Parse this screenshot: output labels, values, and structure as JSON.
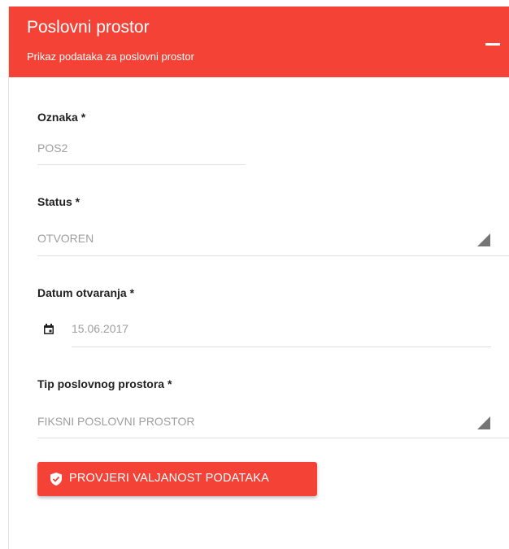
{
  "header": {
    "title": "Poslovni prostor",
    "subtitle": "Prikaz podataka za poslovni prostor"
  },
  "fields": {
    "oznaka": {
      "label": "Oznaka *",
      "value": "POS2"
    },
    "status": {
      "label": "Status *",
      "value": "OTVOREN"
    },
    "datum": {
      "label": "Datum otvaranja *",
      "value": "15.06.2017",
      "icon": "calendar-icon"
    },
    "tip": {
      "label": "Tip poslovnog prostora *",
      "value": "FIKSNI POSLOVNI PROSTOR"
    }
  },
  "actions": {
    "validate_label": "PROVJERI VALJANOST PODATAKA",
    "validate_icon": "shield-check-icon"
  },
  "colors": {
    "accent": "#f44336",
    "label": "#212121",
    "value": "#9e9e9e",
    "divider": "#e0e0e0"
  }
}
